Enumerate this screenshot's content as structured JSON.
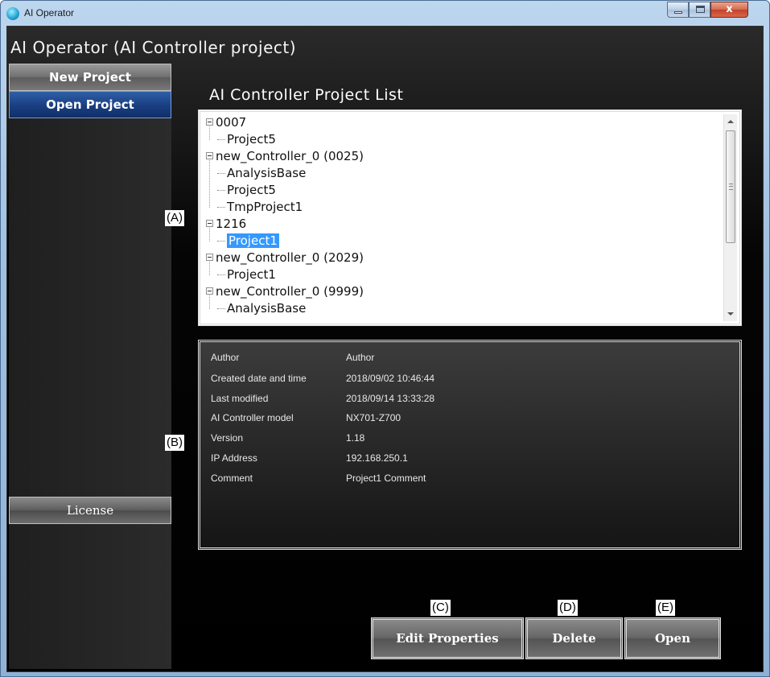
{
  "window": {
    "title": "AI Operator",
    "close_glyph": "x"
  },
  "app": {
    "heading": "AI Operator (AI Controller project)"
  },
  "sidebar": {
    "new_project": "New Project",
    "open_project": "Open Project",
    "license": "License"
  },
  "project_list": {
    "title": "AI Controller Project List",
    "tree": [
      {
        "level": 0,
        "label": "0007"
      },
      {
        "level": 1,
        "label": "Project5"
      },
      {
        "level": 0,
        "label": "new_Controller_0 (0025)"
      },
      {
        "level": 1,
        "label": "AnalysisBase"
      },
      {
        "level": 1,
        "label": "Project5"
      },
      {
        "level": 1,
        "label": "TmpProject1"
      },
      {
        "level": 0,
        "label": "1216"
      },
      {
        "level": 1,
        "label": "Project1",
        "selected": true
      },
      {
        "level": 0,
        "label": "new_Controller_0 (2029)"
      },
      {
        "level": 1,
        "label": "Project1"
      },
      {
        "level": 0,
        "label": "new_Controller_0 (9999)"
      },
      {
        "level": 1,
        "label": "AnalysisBase"
      }
    ]
  },
  "properties": {
    "rows": [
      {
        "label": "Author",
        "value": "Author"
      },
      {
        "label": "Created date and time",
        "value": "2018/09/02 10:46:44"
      },
      {
        "label": "Last modified",
        "value": "2018/09/14 13:33:28"
      },
      {
        "label": "AI Controller model",
        "value": "NX701-Z700"
      },
      {
        "label": "Version",
        "value": "1.18"
      },
      {
        "label": "IP Address",
        "value": "192.168.250.1"
      },
      {
        "label": "Comment",
        "value": "Project1 Comment"
      }
    ]
  },
  "callouts": {
    "a": "(A)",
    "b": "(B)",
    "c": "(C)",
    "d": "(D)",
    "e": "(E)"
  },
  "actions": {
    "edit_properties": "Edit Properties",
    "delete": "Delete",
    "open": "Open"
  },
  "colors": {
    "selection": "#3399ff",
    "open_project_active": "#1a3e80"
  }
}
